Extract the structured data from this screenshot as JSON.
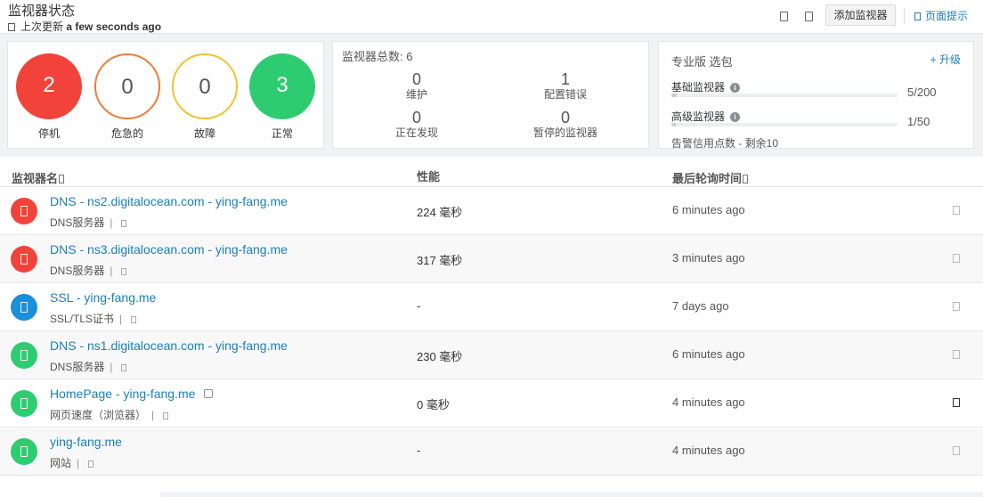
{
  "header": {
    "title": "监视器状态",
    "last_updated_prefix": "上次更新",
    "last_updated_value": "a few seconds ago",
    "add_monitor_label": "添加监视器",
    "page_tips_label": "页面提示"
  },
  "status_summary": {
    "down": {
      "count": "2",
      "label": "停机",
      "color": "#f2433b"
    },
    "critical": {
      "count": "0",
      "label": "危急的",
      "color": "#ef7d3a"
    },
    "trouble": {
      "count": "0",
      "label": "故障",
      "color": "#f1c232"
    },
    "up": {
      "count": "3",
      "label": "正常",
      "color": "#2ecc71"
    }
  },
  "monitor_totals": {
    "title": "监视器总数: 6",
    "maintenance": {
      "count": "0",
      "label": "维护"
    },
    "config_error": {
      "count": "1",
      "label": "配置错误"
    },
    "discovering": {
      "count": "0",
      "label": "正在发现"
    },
    "paused": {
      "count": "0",
      "label": "暂停的监视器"
    }
  },
  "plan": {
    "title": "专业版 选包",
    "upgrade_label": "+ 升级",
    "basic_label": "基础监视器",
    "basic_count": "5/200",
    "basic_usage": 0.025,
    "advanced_label": "高级监视器",
    "advanced_count": "1/50",
    "advanced_usage": 0.02,
    "credits": "告警信用点数 - 剩余10"
  },
  "table": {
    "col_name": "监视器名",
    "col_perf": "性能",
    "col_poll": "最后轮询时间",
    "rows": [
      {
        "name": "DNS - ns2.digitalocean.com - ying-fang.me",
        "type": "DNS服务器",
        "perf": "224 毫秒",
        "poll": "6 minutes ago",
        "status": "red"
      },
      {
        "name": "DNS - ns3.digitalocean.com - ying-fang.me",
        "type": "DNS服务器",
        "perf": "317 毫秒",
        "poll": "3 minutes ago",
        "status": "red"
      },
      {
        "name": "SSL - ying-fang.me",
        "type": "SSL/TLS证书",
        "perf": "-",
        "poll": "7 days ago",
        "status": "blue"
      },
      {
        "name": "DNS - ns1.digitalocean.com - ying-fang.me",
        "type": "DNS服务器",
        "perf": "230 毫秒",
        "poll": "6 minutes ago",
        "status": "green"
      },
      {
        "name": "HomePage - ying-fang.me",
        "type": "网页速度（浏览器）",
        "perf": "0 毫秒",
        "poll": "4 minutes ago",
        "status": "green"
      },
      {
        "name": "ying-fang.me",
        "type": "网站",
        "perf": "-",
        "poll": "4 minutes ago",
        "status": "green"
      }
    ]
  }
}
